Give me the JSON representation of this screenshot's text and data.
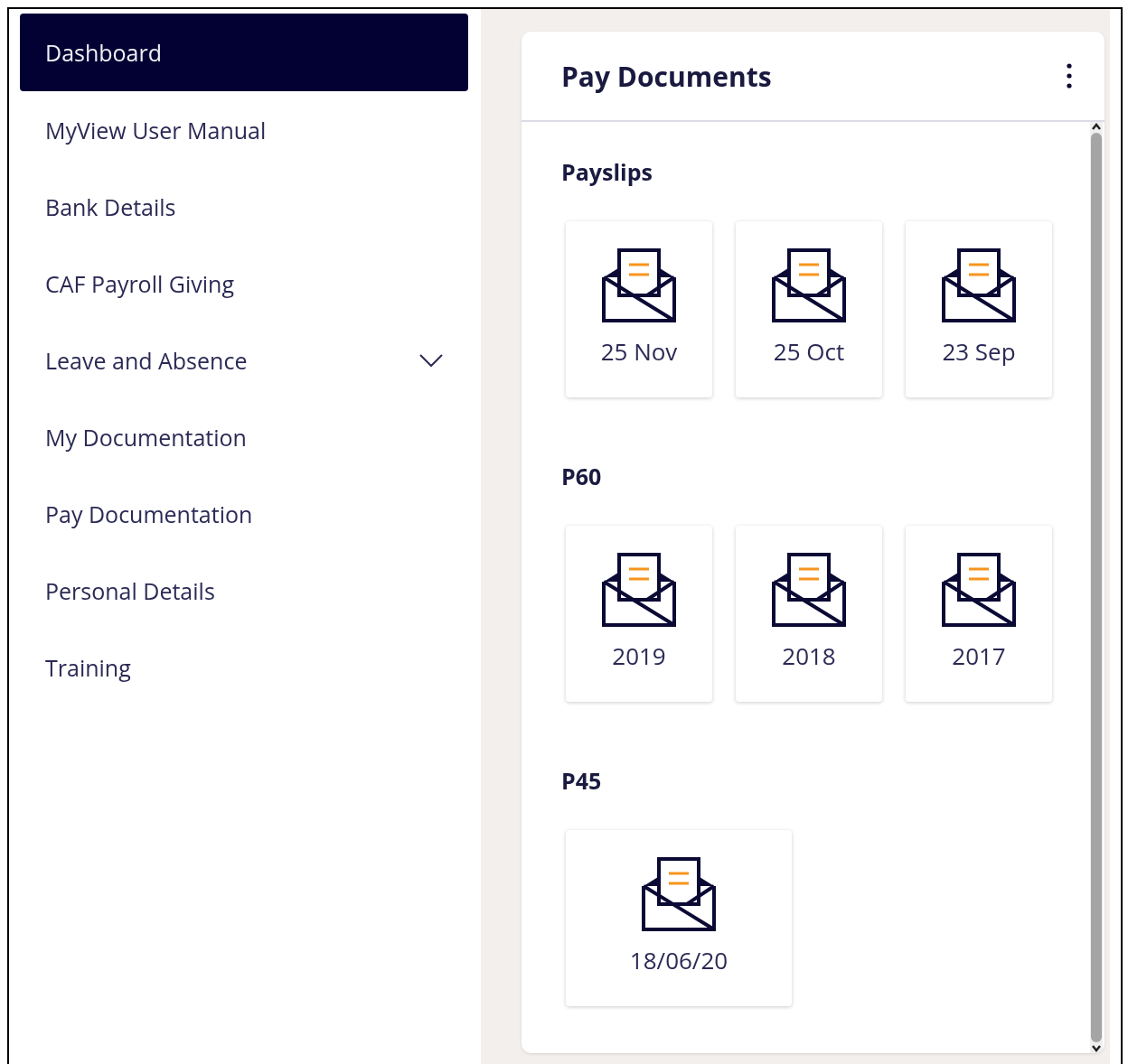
{
  "sidebar": {
    "items": [
      {
        "label": "Dashboard",
        "selected": true,
        "kind": "link"
      },
      {
        "label": "MyView User Manual",
        "selected": false,
        "kind": "link"
      },
      {
        "label": "Bank Details",
        "selected": false,
        "kind": "link"
      },
      {
        "label": "CAF Payroll Giving",
        "selected": false,
        "kind": "link"
      },
      {
        "label": "Leave and Absence",
        "selected": false,
        "kind": "group",
        "expanded": false
      },
      {
        "label": "My Documentation",
        "selected": false,
        "kind": "link"
      },
      {
        "label": "Pay Documentation",
        "selected": false,
        "kind": "link"
      },
      {
        "label": "Personal Details",
        "selected": false,
        "kind": "link"
      },
      {
        "label": "Training",
        "selected": false,
        "kind": "link"
      }
    ]
  },
  "card": {
    "title": "Pay Documents",
    "sections": [
      {
        "title": "Payslips",
        "documents": [
          "25 Nov",
          "25 Oct",
          "23 Sep"
        ]
      },
      {
        "title": "P60",
        "documents": [
          "2019",
          "2018",
          "2017"
        ]
      },
      {
        "title": "P45",
        "wide": true,
        "documents": [
          "18/06/20"
        ]
      }
    ]
  }
}
